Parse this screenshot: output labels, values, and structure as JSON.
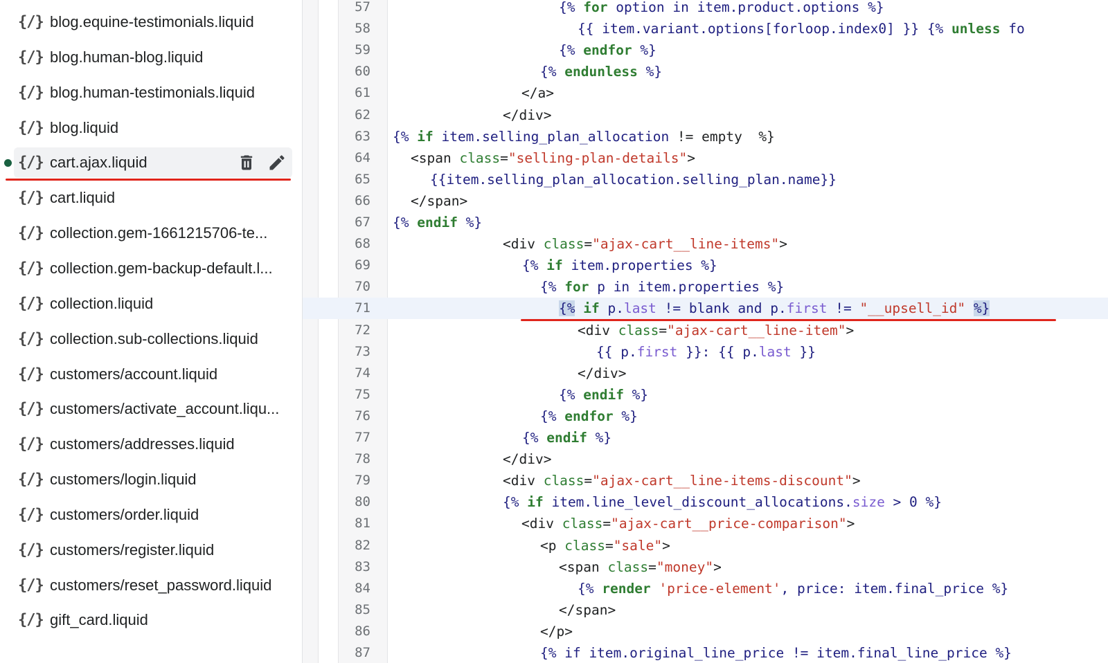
{
  "sidebar": {
    "active_index": 4,
    "files": [
      {
        "icon": "{/}",
        "name": "blog.equine-testimonials.liquid"
      },
      {
        "icon": "{/}",
        "name": "blog.human-blog.liquid"
      },
      {
        "icon": "{/}",
        "name": "blog.human-testimonials.liquid"
      },
      {
        "icon": "{/}",
        "name": "blog.liquid"
      },
      {
        "icon": "{/}",
        "name": "cart.ajax.liquid"
      },
      {
        "icon": "{/}",
        "name": "cart.liquid"
      },
      {
        "icon": "{/}",
        "name": "collection.gem-1661215706-te..."
      },
      {
        "icon": "{/}",
        "name": "collection.gem-backup-default.l..."
      },
      {
        "icon": "{/}",
        "name": "collection.liquid"
      },
      {
        "icon": "{/}",
        "name": "collection.sub-collections.liquid"
      },
      {
        "icon": "{/}",
        "name": "customers/account.liquid"
      },
      {
        "icon": "{/}",
        "name": "customers/activate_account.liqu..."
      },
      {
        "icon": "{/}",
        "name": "customers/addresses.liquid"
      },
      {
        "icon": "{/}",
        "name": "customers/login.liquid"
      },
      {
        "icon": "{/}",
        "name": "customers/order.liquid"
      },
      {
        "icon": "{/}",
        "name": "customers/register.liquid"
      },
      {
        "icon": "{/}",
        "name": "customers/reset_password.liquid"
      },
      {
        "icon": "{/}",
        "name": "gift_card.liquid"
      }
    ],
    "active_actions": {
      "delete_icon": "trash-icon",
      "edit_icon": "pencil-icon"
    },
    "modified_dot_color": "#1a6141"
  },
  "editor": {
    "active_line": 71,
    "lines": [
      {
        "n": "57",
        "tokens": [
          [
            "p",
            "{% "
          ],
          [
            "k",
            "for"
          ],
          [
            "p",
            " option in item.product.options %}"
          ]
        ]
      },
      {
        "n": "58",
        "tokens": [
          [
            "p",
            "{{ item.variant.options[forloop.index0] }} {% "
          ],
          [
            "k",
            "unless"
          ],
          [
            "p",
            " fo"
          ]
        ]
      },
      {
        "n": "59",
        "tokens": [
          [
            "p",
            "{% "
          ],
          [
            "k",
            "endfor"
          ],
          [
            "p",
            " %}"
          ]
        ]
      },
      {
        "n": "60",
        "tokens": [
          [
            "p",
            "{% "
          ],
          [
            "k",
            "endunless"
          ],
          [
            "p",
            " %}"
          ]
        ]
      },
      {
        "n": "61",
        "tokens": [
          [
            "t",
            "</a>"
          ]
        ]
      },
      {
        "n": "62",
        "tokens": [
          [
            "t",
            "</div>"
          ]
        ]
      },
      {
        "n": "63",
        "tokens": [
          [
            "p",
            "{% "
          ],
          [
            "k",
            "if"
          ],
          [
            "p",
            " item.selling_plan_allocation "
          ],
          [
            "t",
            "!= empty  %}"
          ]
        ]
      },
      {
        "n": "64",
        "tokens": [
          [
            "t",
            "<span "
          ],
          [
            "a",
            "class"
          ],
          [
            "t",
            "="
          ],
          [
            "s",
            "\"selling-plan-details\""
          ],
          [
            "t",
            ">"
          ]
        ]
      },
      {
        "n": "65",
        "tokens": [
          [
            "p",
            "{{item.selling_plan_allocation.selling_plan.name}}"
          ]
        ]
      },
      {
        "n": "66",
        "tokens": [
          [
            "t",
            "</span>"
          ]
        ]
      },
      {
        "n": "67",
        "tokens": [
          [
            "p",
            "{% "
          ],
          [
            "k",
            "endif"
          ],
          [
            "p",
            " %}"
          ]
        ]
      },
      {
        "n": "68",
        "tokens": [
          [
            "t",
            "<div "
          ],
          [
            "a",
            "class"
          ],
          [
            "t",
            "="
          ],
          [
            "s",
            "\"ajax-cart__line-items\""
          ],
          [
            "t",
            ">"
          ]
        ]
      },
      {
        "n": "69",
        "tokens": [
          [
            "p",
            "{% "
          ],
          [
            "k",
            "if"
          ],
          [
            "p",
            " item.properties %}"
          ]
        ]
      },
      {
        "n": "70",
        "tokens": [
          [
            "p",
            "{% "
          ],
          [
            "k",
            "for"
          ],
          [
            "p",
            " p in item.properties %}"
          ]
        ]
      },
      {
        "n": "71",
        "tokens": [
          [
            "h",
            "{%"
          ],
          [
            "p",
            " "
          ],
          [
            "k",
            "if"
          ],
          [
            "p",
            " p."
          ],
          [
            "r",
            "last"
          ],
          [
            "p",
            " != blank and p."
          ],
          [
            "r",
            "first"
          ],
          [
            "p",
            " != "
          ],
          [
            "s",
            "\"__upsell_id\""
          ],
          [
            "p",
            " "
          ],
          [
            "h",
            "%}"
          ]
        ]
      },
      {
        "n": "72",
        "tokens": [
          [
            "t",
            "<div "
          ],
          [
            "a",
            "class"
          ],
          [
            "t",
            "="
          ],
          [
            "s",
            "\"ajax-cart__line-item\""
          ],
          [
            "t",
            ">"
          ]
        ]
      },
      {
        "n": "73",
        "tokens": [
          [
            "p",
            "{{ p."
          ],
          [
            "r",
            "first"
          ],
          [
            "p",
            " }}: {{ p."
          ],
          [
            "r",
            "last"
          ],
          [
            "p",
            " }}"
          ]
        ]
      },
      {
        "n": "74",
        "tokens": [
          [
            "t",
            "</div>"
          ]
        ]
      },
      {
        "n": "75",
        "tokens": [
          [
            "p",
            "{% "
          ],
          [
            "k",
            "endif"
          ],
          [
            "p",
            " %}"
          ]
        ]
      },
      {
        "n": "76",
        "tokens": [
          [
            "p",
            "{% "
          ],
          [
            "k",
            "endfor"
          ],
          [
            "p",
            " %}"
          ]
        ]
      },
      {
        "n": "77",
        "tokens": [
          [
            "p",
            "{% "
          ],
          [
            "k",
            "endif"
          ],
          [
            "p",
            " %}"
          ]
        ]
      },
      {
        "n": "78",
        "tokens": [
          [
            "t",
            "</div>"
          ]
        ]
      },
      {
        "n": "79",
        "tokens": [
          [
            "t",
            "<div "
          ],
          [
            "a",
            "class"
          ],
          [
            "t",
            "="
          ],
          [
            "s",
            "\"ajax-cart__line-items-discount\""
          ],
          [
            "t",
            ">"
          ]
        ]
      },
      {
        "n": "80",
        "tokens": [
          [
            "p",
            "{% "
          ],
          [
            "k",
            "if"
          ],
          [
            "p",
            " item.line_level_discount_allocations."
          ],
          [
            "r",
            "size"
          ],
          [
            "p",
            " > 0 %}"
          ]
        ]
      },
      {
        "n": "81",
        "tokens": [
          [
            "t",
            "<div "
          ],
          [
            "a",
            "class"
          ],
          [
            "t",
            "="
          ],
          [
            "s",
            "\"ajax-cart__price-comparison\""
          ],
          [
            "t",
            ">"
          ]
        ]
      },
      {
        "n": "82",
        "tokens": [
          [
            "t",
            "<p "
          ],
          [
            "a",
            "class"
          ],
          [
            "t",
            "="
          ],
          [
            "s",
            "\"sale\""
          ],
          [
            "t",
            ">"
          ]
        ]
      },
      {
        "n": "83",
        "tokens": [
          [
            "t",
            "<span "
          ],
          [
            "a",
            "class"
          ],
          [
            "t",
            "="
          ],
          [
            "s",
            "\"money\""
          ],
          [
            "t",
            ">"
          ]
        ]
      },
      {
        "n": "84",
        "tokens": [
          [
            "p",
            "{% "
          ],
          [
            "k",
            "render"
          ],
          [
            "p",
            " "
          ],
          [
            "s",
            "'price-element'"
          ],
          [
            "p",
            ", price: item.final_price %}"
          ]
        ]
      },
      {
        "n": "85",
        "tokens": [
          [
            "t",
            "</span>"
          ]
        ]
      },
      {
        "n": "86",
        "tokens": [
          [
            "t",
            "</p>"
          ]
        ]
      },
      {
        "n": "87",
        "tokens": [
          [
            "p",
            "{% if item.original_line_price != item.final_line_price %}"
          ]
        ]
      }
    ]
  },
  "colors": {
    "keyword": "#2f7d32",
    "string": "#c0392b",
    "attribute": "#2e7d32",
    "property": "#7a5cd0",
    "object": "#1f1f80",
    "annotation_underline": "#e0251b",
    "active_line_bg": "#eef3fb"
  }
}
